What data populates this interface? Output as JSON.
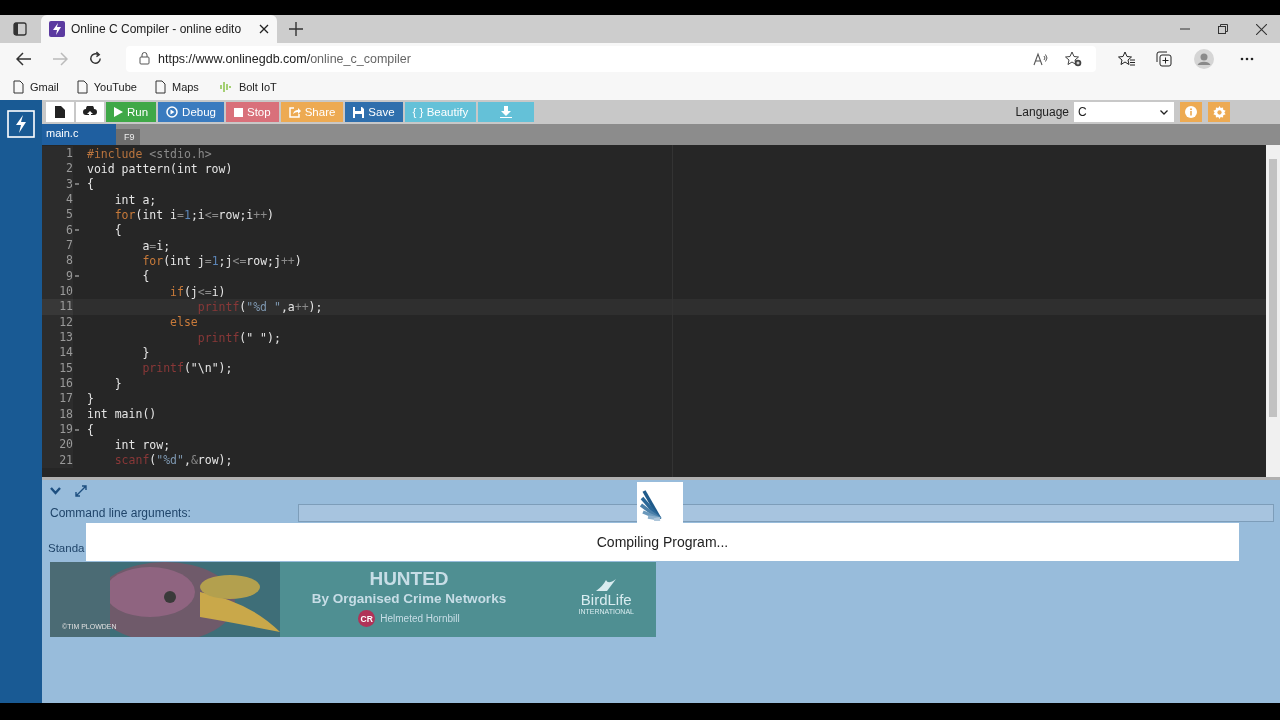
{
  "browser": {
    "tab_title": "Online C Compiler - online edito",
    "url_host": "https://www.onlinegdb.com/",
    "url_path": "online_c_compiler",
    "bookmarks": [
      {
        "label": "Gmail",
        "kind": "page"
      },
      {
        "label": "YouTube",
        "kind": "page"
      },
      {
        "label": "Maps",
        "kind": "page"
      },
      {
        "label": "Bolt IoT",
        "kind": "wave"
      }
    ]
  },
  "toolbar": {
    "buttons": [
      {
        "label": "Run",
        "kind": "run"
      },
      {
        "label": "Debug",
        "kind": "debug"
      },
      {
        "label": "Stop",
        "kind": "stop"
      },
      {
        "label": "Share",
        "kind": "share"
      },
      {
        "label": "Save",
        "kind": "save"
      },
      {
        "label": "{ } Beautify",
        "kind": "beautify"
      }
    ],
    "language_label": "Language",
    "language": "C",
    "tooltip": "F9"
  },
  "file_tab": "main.c",
  "code": [
    {
      "n": "1",
      "fold": false,
      "active": false,
      "tokens": [
        {
          "kind": "pre",
          "text": "#include"
        },
        {
          "kind": "inc",
          "text": " <stdio.h>"
        }
      ]
    },
    {
      "n": "2",
      "fold": false,
      "active": false,
      "tokens": [
        {
          "kind": "plain",
          "text": "void pattern(int row)"
        }
      ]
    },
    {
      "n": "3",
      "fold": true,
      "active": false,
      "tokens": [
        {
          "kind": "plain",
          "text": "{"
        }
      ]
    },
    {
      "n": "4",
      "fold": false,
      "active": false,
      "tokens": [
        {
          "kind": "plain",
          "text": "    int a;"
        }
      ]
    },
    {
      "n": "5",
      "fold": false,
      "active": false,
      "tokens": [
        {
          "kind": "kw",
          "text": "    for"
        },
        {
          "kind": "plain",
          "text": "(int i"
        },
        {
          "kind": "op",
          "text": "="
        },
        {
          "kind": "num",
          "text": "1"
        },
        {
          "kind": "plain",
          "text": ";i"
        },
        {
          "kind": "op",
          "text": "<="
        },
        {
          "kind": "plain",
          "text": "row;i"
        },
        {
          "kind": "op",
          "text": "++"
        },
        {
          "kind": "plain",
          "text": ")"
        }
      ]
    },
    {
      "n": "6",
      "fold": true,
      "active": false,
      "tokens": [
        {
          "kind": "plain",
          "text": "    {"
        }
      ]
    },
    {
      "n": "7",
      "fold": false,
      "active": false,
      "tokens": [
        {
          "kind": "plain",
          "text": "        a"
        },
        {
          "kind": "op",
          "text": "="
        },
        {
          "kind": "plain",
          "text": "i;"
        }
      ]
    },
    {
      "n": "8",
      "fold": false,
      "active": false,
      "tokens": [
        {
          "kind": "kw",
          "text": "        for"
        },
        {
          "kind": "plain",
          "text": "(int j"
        },
        {
          "kind": "op",
          "text": "="
        },
        {
          "kind": "num",
          "text": "1"
        },
        {
          "kind": "plain",
          "text": ";j"
        },
        {
          "kind": "op",
          "text": "<="
        },
        {
          "kind": "plain",
          "text": "row;j"
        },
        {
          "kind": "op",
          "text": "++"
        },
        {
          "kind": "plain",
          "text": ")"
        }
      ]
    },
    {
      "n": "9",
      "fold": true,
      "active": false,
      "tokens": [
        {
          "kind": "plain",
          "text": "        {"
        }
      ]
    },
    {
      "n": "10",
      "fold": false,
      "active": false,
      "tokens": [
        {
          "kind": "kw",
          "text": "            if"
        },
        {
          "kind": "plain",
          "text": "(j"
        },
        {
          "kind": "op",
          "text": "<="
        },
        {
          "kind": "plain",
          "text": "i)"
        }
      ]
    },
    {
      "n": "11",
      "fold": false,
      "active": true,
      "tokens": [
        {
          "kind": "fn",
          "text": "                printf"
        },
        {
          "kind": "plain",
          "text": "("
        },
        {
          "kind": "str",
          "text": "\"%d \""
        },
        {
          "kind": "plain",
          "text": ",a"
        },
        {
          "kind": "op",
          "text": "++"
        },
        {
          "kind": "plain",
          "text": ");"
        }
      ]
    },
    {
      "n": "12",
      "fold": false,
      "active": false,
      "tokens": [
        {
          "kind": "kw",
          "text": "            else"
        }
      ]
    },
    {
      "n": "13",
      "fold": false,
      "active": false,
      "tokens": [
        {
          "kind": "fn",
          "text": "                printf"
        },
        {
          "kind": "plain",
          "text": "(\" \");"
        }
      ]
    },
    {
      "n": "14",
      "fold": false,
      "active": false,
      "tokens": [
        {
          "kind": "plain",
          "text": "        }"
        }
      ]
    },
    {
      "n": "15",
      "fold": false,
      "active": false,
      "tokens": [
        {
          "kind": "fn",
          "text": "        printf"
        },
        {
          "kind": "plain",
          "text": "(\"\\n\");"
        }
      ]
    },
    {
      "n": "16",
      "fold": false,
      "active": false,
      "tokens": [
        {
          "kind": "plain",
          "text": "    }"
        }
      ]
    },
    {
      "n": "17",
      "fold": false,
      "active": false,
      "tokens": [
        {
          "kind": "plain",
          "text": "}"
        }
      ]
    },
    {
      "n": "18",
      "fold": false,
      "active": false,
      "tokens": [
        {
          "kind": "plain",
          "text": "int main()"
        }
      ]
    },
    {
      "n": "19",
      "fold": true,
      "active": false,
      "tokens": [
        {
          "kind": "plain",
          "text": "{"
        }
      ]
    },
    {
      "n": "20",
      "fold": false,
      "active": false,
      "tokens": [
        {
          "kind": "plain",
          "text": "    int row;"
        }
      ]
    },
    {
      "n": "21",
      "fold": false,
      "active": false,
      "tokens": [
        {
          "kind": "fn",
          "text": "    scanf"
        },
        {
          "kind": "plain",
          "text": "("
        },
        {
          "kind": "str",
          "text": "\"%d\""
        },
        {
          "kind": "plain",
          "text": ","
        },
        {
          "kind": "op",
          "text": "&"
        },
        {
          "kind": "plain",
          "text": "row);"
        }
      ]
    }
  ],
  "panel": {
    "args_label": "Command line arguments:",
    "stdin_label": "Standa",
    "status": "Compiling Program..."
  },
  "ad": {
    "kind": "picture",
    "title": "HUNTED",
    "subtitle": "By Organised Crime Networks",
    "badge": "CR",
    "species": "Helmeted Hornbill",
    "credit": "©TIM PLOWDEN",
    "brand": "BirdLife",
    "brand_sub": "INTERNATIONAL"
  }
}
